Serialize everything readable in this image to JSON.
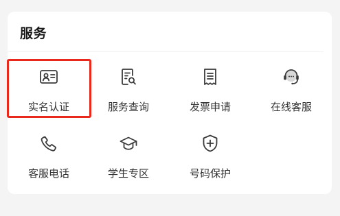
{
  "section": {
    "title": "服务"
  },
  "services": [
    {
      "label": "实名认证",
      "icon": "id-card-icon"
    },
    {
      "label": "服务查询",
      "icon": "document-search-icon"
    },
    {
      "label": "发票申请",
      "icon": "receipt-icon"
    },
    {
      "label": "在线客服",
      "icon": "headset-icon"
    },
    {
      "label": "客服电话",
      "icon": "phone-icon"
    },
    {
      "label": "学生专区",
      "icon": "graduation-cap-icon"
    },
    {
      "label": "号码保护",
      "icon": "shield-plus-icon"
    }
  ],
  "colors": {
    "highlight": "#e8291c",
    "icon": "#3a3a3a",
    "icon_accent": "#d8d8d8"
  }
}
